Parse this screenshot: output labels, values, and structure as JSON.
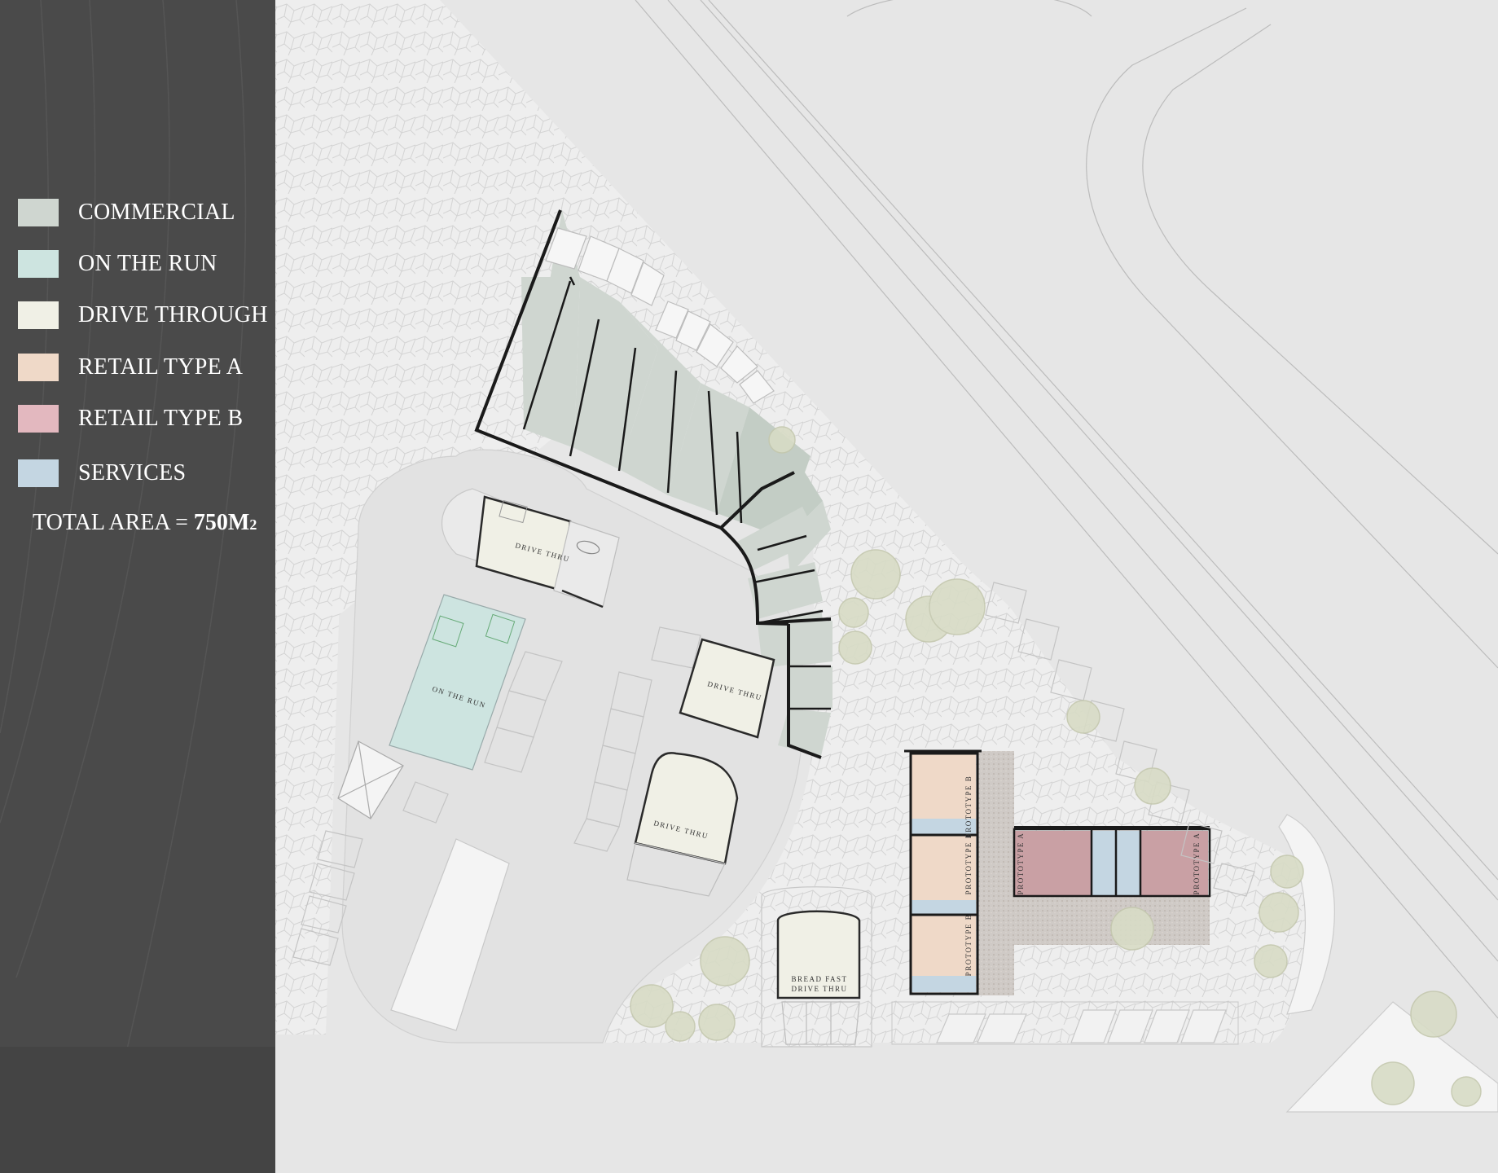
{
  "legend": {
    "items": [
      {
        "label": "COMMERCIAL",
        "color": "#cfd6d0"
      },
      {
        "label": "ON THE RUN",
        "color": "#cde4e0"
      },
      {
        "label": "DRIVE THROUGH",
        "color": "#f0f0e6"
      },
      {
        "label": "RETAIL TYPE A",
        "color": "#efd9c8"
      },
      {
        "label": "RETAIL TYPE B",
        "color": "#e3b8bf"
      },
      {
        "label": "SERVICES",
        "color": "#c4d6e2"
      }
    ],
    "total_label": "TOTAL AREA = ",
    "total_value": "750",
    "total_unit": "M",
    "total_unit_sub": "2"
  },
  "plan": {
    "labels": {
      "drive_thru": "DRIVE THRU",
      "on_the_run": "ON THE RUN",
      "bread_fast_1": "BREAD FAST",
      "bread_fast_2": "DRIVE THRU",
      "prototype_a": "PROTOTYPE A",
      "prototype_b": "PROTOTYPE B"
    },
    "colors": {
      "ground": "#e6e6e6",
      "paving": "#eeeeee",
      "road": "#e2e2e2",
      "commercial": "#cfd6d0",
      "commercial_dark": "#c3cdc5",
      "on_the_run": "#cde4e0",
      "drive_through": "#f0f0e6",
      "retail_a": "#efd9c8",
      "retail_b": "#c9a0a4",
      "services": "#c4d6e2",
      "tree": "#d8dcc6",
      "wall": "#1a1a1a"
    }
  }
}
